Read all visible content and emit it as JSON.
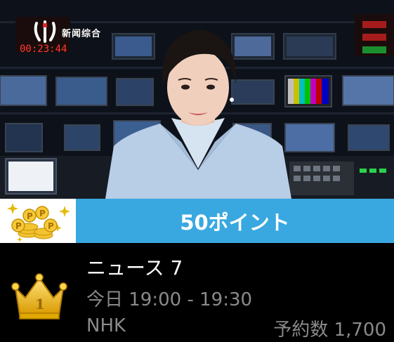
{
  "video": {
    "channel_logo_text": "新闻综合",
    "clock_text": "00:23:44",
    "colors": {
      "bar_blue": "#3aa8e0"
    }
  },
  "points": {
    "label": "50ポイント"
  },
  "program": {
    "title": "ニュース 7",
    "time": "今日 19:00 - 19:30",
    "channel": "NHK",
    "reservations": "予約数 1,700",
    "rank": "1"
  }
}
